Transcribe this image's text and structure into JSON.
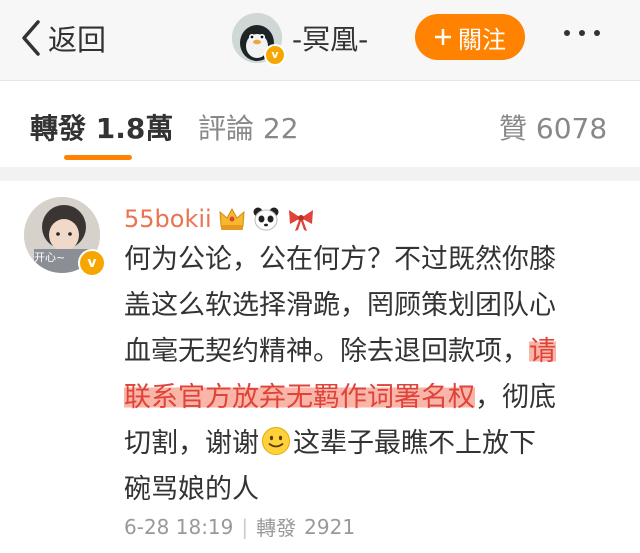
{
  "header": {
    "back_label": "返回",
    "title": "-冥凰-",
    "follow_label": "關注",
    "verified_mark": "v",
    "colors": {
      "follow_bg": "#ff8200",
      "verified": "#f7a600"
    }
  },
  "tabs": [
    {
      "label": "轉發",
      "count": "1.8萬",
      "active": true
    },
    {
      "label": "評論",
      "count": "22",
      "active": false
    },
    {
      "label": "贊",
      "count": "6078",
      "active": false
    }
  ],
  "post": {
    "username": "55bokii",
    "avatar_caption": "开心~",
    "verified_mark": "v",
    "badges": [
      "crown-badge-icon",
      "panda-icon",
      "bow-icon"
    ],
    "lines": [
      {
        "a": "何为公论，公在何方？不过既然你膝"
      },
      {
        "a": "盖这么软选择滑跪，罔顾策划团队心"
      },
      {
        "a": "血毫无契约精神。除去退回款项，",
        "h": "请"
      },
      {
        "h": "联系官方放弃无羁作词署名权",
        "b": "，彻底"
      },
      {
        "a": "切割，谢谢",
        "b": "这辈子最瞧不上放下"
      },
      {
        "a": "碗骂娘的人"
      }
    ],
    "date": "6-28 18:19",
    "repost_label": "轉發",
    "repost_count": "2921",
    "colors": {
      "username": "#eb7350",
      "highlight": "#e0433a"
    }
  }
}
